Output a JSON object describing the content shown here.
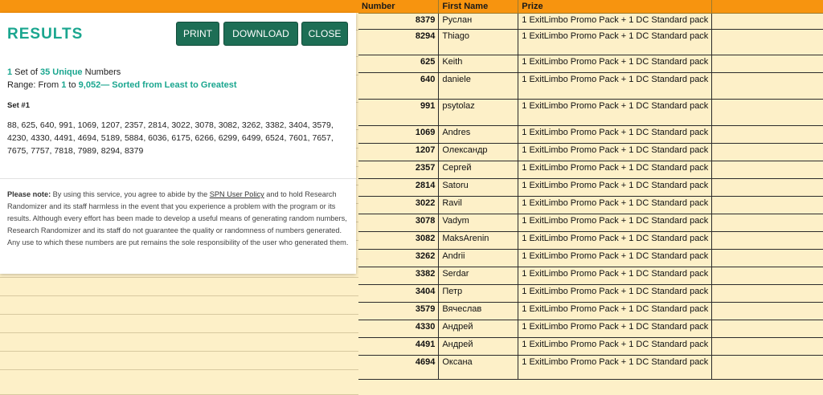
{
  "dialog": {
    "title": "RESULTS",
    "buttons": {
      "print": "PRINT",
      "download": "DOWNLOAD",
      "close": "CLOSE"
    },
    "info": {
      "sets_count": "1",
      "set_of_text": " Set of ",
      "unique_count": "35 Unique",
      "numbers_text": " Numbers",
      "range_prefix": "Range: From ",
      "range_from": "1",
      "range_to_text": " to ",
      "range_to": "9,052",
      "sorted_text": "— Sorted from Least to Greatest"
    },
    "set_label": "Set #1",
    "numbers": "88, 625, 640, 991, 1069, 1207, 2357, 2814, 3022, 3078, 3082, 3262, 3382, 3404, 3579, 4230, 4330, 4491, 4694, 5189, 5884, 6036, 6175, 6266, 6299, 6499, 6524, 7601, 7657, 7675, 7757, 7818, 7989, 8294, 8379",
    "note": {
      "label": "Please note:",
      "text_before_link": " By using this service, you agree to abide by the ",
      "link": "SPN User Policy",
      "text_after_link": " and to hold Research Randomizer and its staff harmless in the event that you experience a problem with the program or its results. Although every effort has been made to develop a useful means of generating random numbers, Research Randomizer and its staff do not guarantee the quality or randomness of numbers generated. Any use to which these numbers are put remains the sole responsibility of the user who generated them."
    }
  },
  "sheet": {
    "headers": {
      "number": "Number",
      "first_name": "First Name",
      "prize": "Prize"
    },
    "rows": [
      {
        "number": "8379",
        "name": "Руслан",
        "prize": "1 ExitLimbo Promo Pack + 1 DC Standard pack"
      },
      {
        "number": "8294",
        "name": "Thiago",
        "prize": "1 ExitLimbo Promo Pack + 1 DC Standard pack"
      },
      {
        "number": "625",
        "name": "Keith",
        "prize": "1 ExitLimbo Promo Pack + 1 DC Standard pack"
      },
      {
        "number": "640",
        "name": "daniele",
        "prize": "1 ExitLimbo Promo Pack + 1 DC Standard pack"
      },
      {
        "number": "991",
        "name": "psytolaz",
        "prize": "1 ExitLimbo Promo Pack + 1 DC Standard pack"
      },
      {
        "number": "1069",
        "name": "Andres",
        "prize": "1 ExitLimbo Promo Pack + 1 DC Standard pack"
      },
      {
        "number": "1207",
        "name": "Олександр",
        "prize": "1 ExitLimbo Promo Pack + 1 DC Standard pack"
      },
      {
        "number": "2357",
        "name": "Сергей",
        "prize": "1 ExitLimbo Promo Pack + 1 DC Standard pack"
      },
      {
        "number": "2814",
        "name": "Satoru",
        "prize": "1 ExitLimbo Promo Pack + 1 DC Standard pack"
      },
      {
        "number": "3022",
        "name": "Ravil",
        "prize": "1 ExitLimbo Promo Pack + 1 DC Standard pack"
      },
      {
        "number": "3078",
        "name": "Vadym",
        "prize": "1 ExitLimbo Promo Pack + 1 DC Standard pack"
      },
      {
        "number": "3082",
        "name": "MaksArenin",
        "prize": "1 ExitLimbo Promo Pack + 1 DC Standard pack"
      },
      {
        "number": "3262",
        "name": "Andrii",
        "prize": "1 ExitLimbo Promo Pack + 1 DC Standard pack"
      },
      {
        "number": "3382",
        "name": "Serdar",
        "prize": "1 ExitLimbo Promo Pack + 1 DC Standard pack"
      },
      {
        "number": "3404",
        "name": "Петр",
        "prize": "1 ExitLimbo Promo Pack + 1 DC Standard pack"
      },
      {
        "number": "3579",
        "name": "Вячеслав",
        "prize": "1 ExitLimbo Promo Pack + 1 DC Standard pack"
      },
      {
        "number": "4330",
        "name": "Андрей",
        "prize": "1 ExitLimbo Promo Pack + 1 DC Standard pack"
      },
      {
        "number": "4491",
        "name": "Андрей",
        "prize": "1 ExitLimbo Promo Pack + 1 DC Standard pack"
      },
      {
        "number": "4694",
        "name": "Оксана",
        "prize": "1 ExitLimbo Promo Pack + 1 DC Standard pack"
      }
    ]
  },
  "colors": {
    "header_orange": "#f7940f",
    "cell_cream": "#fdf0c8",
    "accent_teal": "#1aa68f",
    "button_green": "#1d6e55"
  }
}
